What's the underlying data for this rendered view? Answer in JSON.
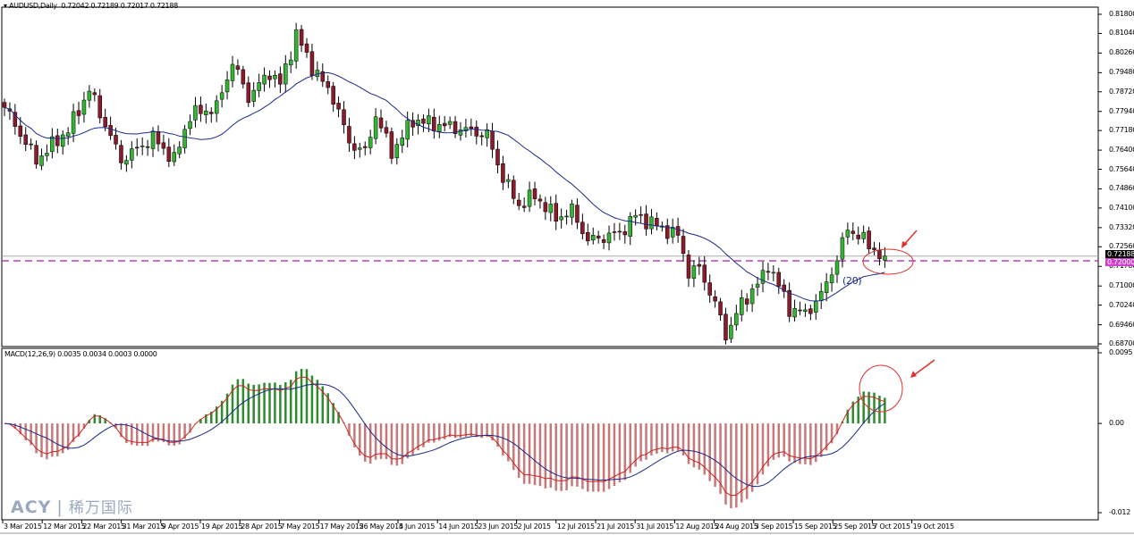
{
  "header": {
    "symbol": "AUDUSD,Daily",
    "ohlc": "0.72042 0.72189 0.72017 0.72188"
  },
  "macd_label": "MACD(12,26,9) 0.0035 0.0034 0.0003 0.0000",
  "ma_label": "(20)",
  "logo": {
    "brand": "ACY",
    "separator": "|",
    "cn": "稀万国际"
  },
  "colors": {
    "bull": "#33b533",
    "bear": "#8b1a2a",
    "hist_pos": "#2e8b2e",
    "hist_neg": "#c87878",
    "ma": "#1a2a8a",
    "macd": "#d02020",
    "signal": "#1a2a8a",
    "hline": "#b030b0",
    "annot": "#e03030"
  },
  "chart_data": {
    "type": "candlestick",
    "symbol": "AUDUSD",
    "timeframe": "Daily",
    "price_axis": {
      "ylim": [
        0.687,
        0.818
      ],
      "ticks": [
        "0.81800",
        "0.81040",
        "0.80260",
        "0.79480",
        "0.78720",
        "0.77940",
        "0.77180",
        "0.76400",
        "0.75640",
        "0.74860",
        "0.74100",
        "0.73320",
        "0.72560",
        "0.71780",
        "0.71000",
        "0.70240",
        "0.69460",
        "0.68700"
      ],
      "tick_values": [
        0.818,
        0.8104,
        0.8026,
        0.7948,
        0.7872,
        0.7794,
        0.7718,
        0.764,
        0.7564,
        0.7486,
        0.741,
        0.7332,
        0.7256,
        0.7178,
        0.71,
        0.7024,
        0.6946,
        0.687
      ]
    },
    "current_price": {
      "label": "0.72188",
      "value": 0.72188
    },
    "horizontal_line": {
      "label": "0.72000",
      "value": 0.72
    },
    "macd_axis": {
      "ylim": [
        -0.012,
        0.0095
      ],
      "ticks": [
        "0.0095",
        "0.00",
        "-0.012"
      ],
      "tick_values": [
        0.0095,
        0,
        -0.012
      ]
    },
    "x_labels": [
      "3 Mar 2015",
      "12 Mar 2015",
      "22 Mar 2015",
      "31 Mar 2015",
      "9 Apr 2015",
      "19 Apr 2015",
      "28 Apr 2015",
      "7 May 2015",
      "17 May 2015",
      "26 May 2015",
      "4 Jun 2015",
      "14 Jun 2015",
      "23 Jun 2015",
      "2 Jul 2015",
      "12 Jul 2015",
      "21 Jul 2015",
      "31 Jul 2015",
      "12 Aug 2015",
      "24 Aug 2015",
      "3 Sep 2015",
      "15 Sep 2015",
      "25 Sep 2015",
      "7 Oct 2015",
      "19 Oct 2015"
    ],
    "close_keypoints": [
      [
        0,
        0.781
      ],
      [
        6,
        0.76
      ],
      [
        12,
        0.772
      ],
      [
        16,
        0.788
      ],
      [
        22,
        0.76
      ],
      [
        28,
        0.769
      ],
      [
        32,
        0.76
      ],
      [
        35,
        0.778
      ],
      [
        40,
        0.781
      ],
      [
        43,
        0.799
      ],
      [
        46,
        0.785
      ],
      [
        50,
        0.795
      ],
      [
        52,
        0.79
      ],
      [
        55,
        0.81
      ],
      [
        58,
        0.797
      ],
      [
        62,
        0.785
      ],
      [
        65,
        0.767
      ],
      [
        68,
        0.763
      ],
      [
        70,
        0.778
      ],
      [
        73,
        0.763
      ],
      [
        77,
        0.776
      ],
      [
        82,
        0.774
      ],
      [
        87,
        0.772
      ],
      [
        91,
        0.77
      ],
      [
        94,
        0.753
      ],
      [
        97,
        0.742
      ],
      [
        100,
        0.746
      ],
      [
        104,
        0.737
      ],
      [
        107,
        0.74
      ],
      [
        110,
        0.728
      ],
      [
        116,
        0.731
      ],
      [
        119,
        0.738
      ],
      [
        122,
        0.735
      ],
      [
        127,
        0.73
      ],
      [
        129,
        0.7155
      ],
      [
        131,
        0.717
      ],
      [
        134,
        0.703
      ],
      [
        136,
        0.6905
      ],
      [
        139,
        0.703
      ],
      [
        143,
        0.7136
      ],
      [
        144,
        0.719
      ],
      [
        148,
        0.701
      ],
      [
        151,
        0.699
      ],
      [
        154,
        0.7065
      ],
      [
        157,
        0.7207
      ],
      [
        159,
        0.733
      ],
      [
        161,
        0.73
      ],
      [
        164,
        0.7245
      ],
      [
        166,
        0.7202
      ]
    ],
    "indicators": [
      {
        "name": "MA",
        "period": 20
      },
      {
        "name": "MACD",
        "params": [
          12,
          26,
          9
        ],
        "values": [
          0.0035,
          0.0034,
          0.0003,
          0.0
        ]
      }
    ]
  }
}
